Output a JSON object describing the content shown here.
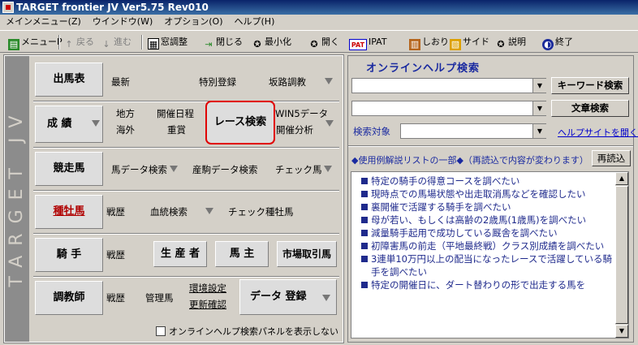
{
  "window": {
    "title": "TARGET frontier JV  Ver5.75  Rev010"
  },
  "menu": [
    "メインメニュー(Z)",
    "ウインドウ(W)",
    "オプション(O)",
    "ヘルプ(H)"
  ],
  "toolbar": [
    {
      "label": "メニューP",
      "icon": "menu-icon"
    },
    {
      "label": "戻る",
      "icon": "up-arrow-icon"
    },
    {
      "label": "進む",
      "icon": "down-arrow-icon"
    },
    {
      "label": "窓調整",
      "icon": "window-adjust-icon"
    },
    {
      "label": "閉じる",
      "icon": "close-icon"
    },
    {
      "label": "最小化",
      "icon": "minimize-icon"
    },
    {
      "label": "開く",
      "icon": "open-icon"
    },
    {
      "label": "IPAT",
      "icon": "pat-icon",
      "badge": "PAT"
    },
    {
      "label": "しおり",
      "icon": "bookmark-icon"
    },
    {
      "label": "サイド",
      "icon": "side-icon"
    },
    {
      "label": "説明",
      "icon": "help-icon"
    },
    {
      "label": "終了",
      "icon": "exit-icon"
    }
  ],
  "left": {
    "brand": "TARGET JV",
    "shutsuba": {
      "label": "出馬表",
      "links": [
        "最新",
        "特別登録",
        "坂路調教"
      ]
    },
    "seiseki": {
      "label": "成 績",
      "links": [
        "地方",
        "開催日程",
        "海外",
        "重賞"
      ],
      "race_search": "レース検索",
      "win5": "WIN5データ",
      "kaisai": "開催分析"
    },
    "kyousouba": {
      "label": "競走馬",
      "links": [
        "馬データ検索",
        "産駒データ検索",
        "チェック馬"
      ]
    },
    "shubo": {
      "label": "種牡馬",
      "links": [
        "戦歴",
        "血統検索",
        "チェック種牡馬"
      ]
    },
    "kishu": {
      "label": "騎 手",
      "links": [
        "戦歴"
      ],
      "buttons": [
        "生 産 者",
        "馬 主",
        "市場取引馬"
      ]
    },
    "choukyou": {
      "label": "調教師",
      "links": [
        "戦歴",
        "管理馬"
      ],
      "env": "環境設定",
      "update": "更新確認",
      "data": "データ 登録"
    },
    "checkbox": "オンラインヘルプ検索パネルを表示しない"
  },
  "right": {
    "title": "オンラインヘルプ検索",
    "keyword_btn": "キーワード検索",
    "text_btn": "文章検索",
    "target_label": "検索対象",
    "help_link": "ヘルプサイトを開く",
    "list_header": "◆使用例解説リストの一部◆（再読込で内容が変わります）",
    "reload": "再読込",
    "items": [
      "特定の騎手の得意コースを調べたい",
      "現時点での馬場状態や出走取消馬などを確認したい",
      "裏開催で活躍する騎手を調べたい",
      "母が若い、もしくは高齢の2歳馬(1歳馬)を調べたい",
      "減量騎手起用で成功している厩舎を調べたい",
      "初障害馬の前走（平地最終戦）クラス別成績を調べたい",
      "3連単10万円以上の配当になったレースで活躍している騎手を調べたい",
      "特定の開催日に、ダート替わりの形で出走する馬を"
    ]
  }
}
